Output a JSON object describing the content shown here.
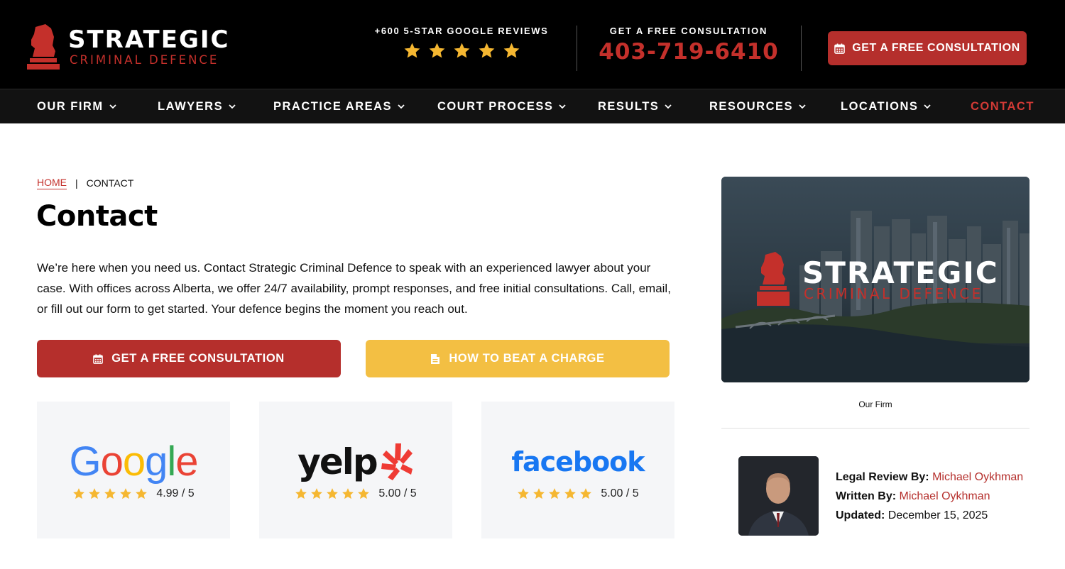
{
  "brand": {
    "name_line1": "STRATEGIC",
    "name_line2": "CRIMINAL DEFENCE",
    "accent_color": "#c4302b"
  },
  "header": {
    "reviews_label": "+600 5-STAR GOOGLE REVIEWS",
    "reviews_stars": 5,
    "consult_label": "GET A FREE CONSULTATION",
    "phone": "403-719-6410",
    "cta_label": "GET A FREE CONSULTATION",
    "cta_icon": "calendar-icon"
  },
  "nav": {
    "items": [
      {
        "label": "OUR FIRM",
        "has_dropdown": true
      },
      {
        "label": "LAWYERS",
        "has_dropdown": true
      },
      {
        "label": "PRACTICE AREAS",
        "has_dropdown": true
      },
      {
        "label": "COURT PROCESS",
        "has_dropdown": true
      },
      {
        "label": "RESULTS",
        "has_dropdown": true
      },
      {
        "label": "RESOURCES",
        "has_dropdown": true
      },
      {
        "label": "LOCATIONS",
        "has_dropdown": true
      },
      {
        "label": "CONTACT",
        "has_dropdown": false,
        "active": true
      }
    ]
  },
  "breadcrumb": {
    "home": "HOME",
    "separator": "|",
    "current": "CONTACT"
  },
  "page": {
    "title": "Contact",
    "intro": "We’re here when you need us. Contact Strategic Criminal Defence to speak with an experienced lawyer about your case. With offices across Alberta, we offer 24/7 availability, prompt responses, and free initial consultations. Call, email, or fill out our form to get started. Your defence begins the moment you reach out."
  },
  "buttons": {
    "consult_label": "GET A FREE CONSULTATION",
    "consult_icon": "calendar-icon",
    "beat_charge_label": "HOW TO BEAT A CHARGE",
    "beat_charge_icon": "document-icon",
    "red_color": "#b52f2c",
    "yellow_color": "#f3bf43"
  },
  "reviews": [
    {
      "platform": "Google",
      "stars": 5,
      "score": "4.99 / 5"
    },
    {
      "platform": "yelp",
      "stars": 5,
      "score": "5.00 / 5"
    },
    {
      "platform": "facebook",
      "stars": 5,
      "score": "5.00 / 5"
    }
  ],
  "sidebar": {
    "image_caption": "Our Firm",
    "image_logo_line1": "STRATEGIC",
    "image_logo_line2": "CRIMINAL DEFENCE",
    "legal_review_label": "Legal Review By:",
    "legal_review_name": "Michael Oykhman",
    "written_by_label": "Written By:",
    "written_by_name": "Michael Oykhman",
    "updated_label": "Updated:",
    "updated_date": "December 15, 2025"
  },
  "colors": {
    "star": "#f5b731",
    "google_blue": "#4285f4",
    "google_red": "#ea4335",
    "google_yellow": "#fbbc05",
    "google_green": "#34a853",
    "yelp_red": "#ef3b34",
    "facebook_blue": "#1877f2"
  }
}
